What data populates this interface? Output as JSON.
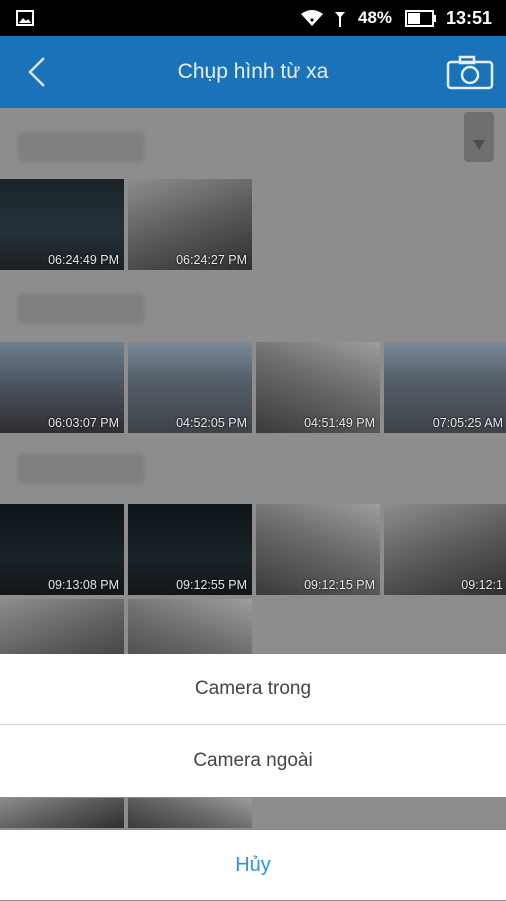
{
  "status_bar": {
    "battery_percent": "48%",
    "time": "13:51",
    "icons": [
      "image-icon",
      "wifi-icon",
      "signal-icon",
      "battery-icon"
    ]
  },
  "app_bar": {
    "title": "Chụp hình từ xa",
    "icons": [
      "back-icon",
      "camera-icon"
    ]
  },
  "gallery": {
    "groups": [
      {
        "thumbs": [
          {
            "time": "06:24:49 PM",
            "kind": "night"
          },
          {
            "time": "06:24:27 PM",
            "kind": "interior"
          }
        ]
      },
      {
        "thumbs": [
          {
            "time": "06:03:07 PM",
            "kind": "dusk"
          },
          {
            "time": "04:52:05 PM",
            "kind": "road"
          },
          {
            "time": "04:51:49 PM",
            "kind": "interior2"
          },
          {
            "time": "07:05:25 AM",
            "kind": "road"
          }
        ]
      },
      {
        "thumbs": [
          {
            "time": "09:13:08 PM",
            "kind": "night2"
          },
          {
            "time": "09:12:55 PM",
            "kind": "night2"
          },
          {
            "time": "09:12:15 PM",
            "kind": "interior2"
          },
          {
            "time": "09:12:1",
            "kind": "interior"
          }
        ]
      }
    ]
  },
  "action_sheet": {
    "option_inside": "Camera trong",
    "option_outside": "Camera ngoài",
    "cancel": "Hủy"
  },
  "colors": {
    "app_bar": "#1a73b8",
    "cancel_text": "#2b95e0"
  }
}
